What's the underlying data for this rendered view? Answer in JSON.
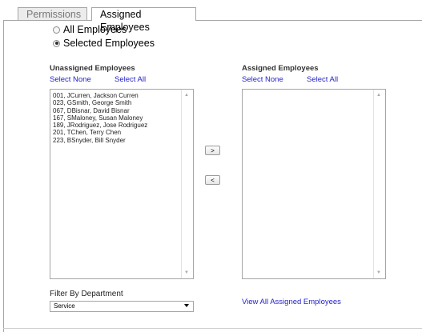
{
  "tabs": [
    {
      "label": "Permissions"
    },
    {
      "label": "Assigned Employees"
    }
  ],
  "scope": {
    "all_label": "All Employees",
    "selected_label": "Selected Employees",
    "selected": "Selected Employees"
  },
  "unassigned": {
    "heading": "Unassigned Employees",
    "select_none": "Select None",
    "select_all": "Select All",
    "items": [
      "001, JCurren, Jackson Curren",
      "023, GSmith, George Smith",
      "067, DBisnar, David Bisnar",
      "167, SMaloney, Susan Maloney",
      "189, JRodriguez, Jose Rodriguez",
      "201, TChen, Terry Chen",
      "223, BSnyder, Bill Snyder"
    ]
  },
  "assigned": {
    "heading": "Assigned Employees",
    "select_none": "Select None",
    "select_all": "Select All",
    "items": []
  },
  "move": {
    "add_label": ">",
    "remove_label": "<"
  },
  "filter": {
    "label": "Filter By Department",
    "value": "Service"
  },
  "view_all_link": "View All Assigned Employees",
  "scroll_up_glyph": "▲",
  "scroll_down_glyph": "▼"
}
